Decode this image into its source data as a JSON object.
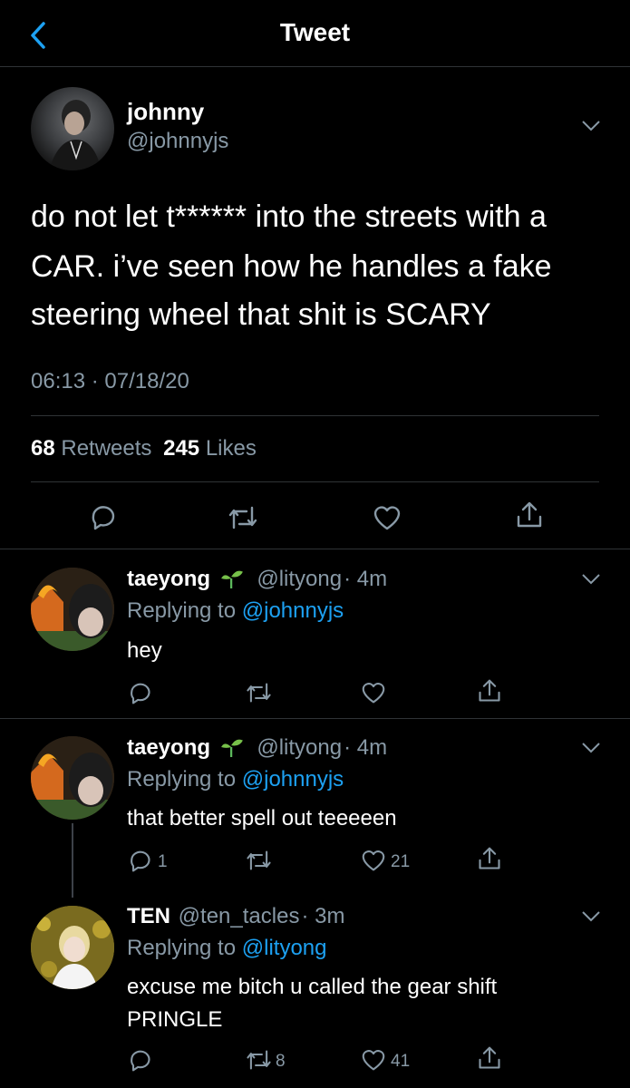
{
  "header": {
    "title": "Tweet"
  },
  "main_tweet": {
    "name": "johnny",
    "handle": "@johnnyjs",
    "text_lines": [
      "do not let t****** into the streets with a",
      "CAR. i’ve seen how he handles a fake",
      "steering wheel that shit is SCARY"
    ],
    "timestamp": "06:13 · 07/18/20",
    "retweets_count": "68",
    "retweets_label": "Retweets",
    "likes_count": "245",
    "likes_label": "Likes"
  },
  "replies": [
    {
      "name": "taeyong",
      "badge": "seedling-icon",
      "handle": "@lityong",
      "time": "· 4m",
      "replying_prefix": "Replying to",
      "replying_to": "@johnnyjs",
      "text_lines": [
        "hey"
      ],
      "reply_count": "",
      "retweet_count": "",
      "like_count": ""
    },
    {
      "name": "taeyong",
      "badge": "seedling-icon",
      "handle": "@lityong",
      "time": "· 4m",
      "replying_prefix": "Replying to",
      "replying_to": "@johnnyjs",
      "text_lines": [
        "that better spell out teeeeen"
      ],
      "reply_count": "1",
      "retweet_count": "",
      "like_count": "21"
    },
    {
      "name": "TEN",
      "handle": "@ten_tacles",
      "time": "· 3m",
      "replying_prefix": "Replying to",
      "replying_to": "@lityong",
      "text_lines": [
        "excuse me bitch u called the gear shift",
        "PRINGLE"
      ],
      "reply_count": "",
      "retweet_count": "8",
      "like_count": "41"
    }
  ],
  "colors": {
    "background": "#000000",
    "secondary_text": "#8899a6",
    "accent": "#1da1f2",
    "divider": "#2f3336"
  }
}
